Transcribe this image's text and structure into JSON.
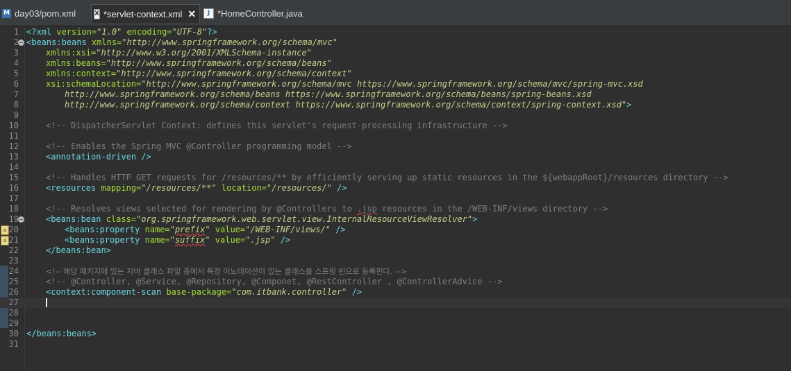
{
  "tabs": [
    {
      "label": "day03/pom.xml",
      "icon": "maven-file-icon"
    },
    {
      "label": "*servlet-context.xml",
      "icon": "xml-file-icon",
      "active": true
    },
    {
      "label": "*HomeController.java",
      "icon": "java-file-icon"
    }
  ],
  "editor": {
    "line_numbers": [
      "1",
      "2",
      "3",
      "4",
      "5",
      "6",
      "7",
      "8",
      "9",
      "10",
      "11",
      "12",
      "13",
      "14",
      "15",
      "16",
      "17",
      "18",
      "19",
      "20",
      "21",
      "22",
      "23",
      "24",
      "25",
      "26",
      "27",
      "28",
      "29",
      "30",
      "31"
    ],
    "lines": {
      "l1": {
        "a": "<?xml ",
        "b": "version=",
        "c": "\"1.0\"",
        "d": " encoding=",
        "e": "\"UTF-8\"",
        "f": "?>"
      },
      "l2": {
        "a": "<beans:beans ",
        "b": "xmlns=",
        "c": "\"http://www.springframework.org/schema/mvc\""
      },
      "l3": {
        "b": "xmlns:xsi=",
        "c": "\"http://www.w3.org/2001/XMLSchema-instance\""
      },
      "l4": {
        "b": "xmlns:beans=",
        "c": "\"http://www.springframework.org/schema/beans\""
      },
      "l5": {
        "b": "xmlns:context=",
        "c": "\"http://www.springframework.org/schema/context\""
      },
      "l6": {
        "b": "xsi:schemaLocation=",
        "c": "\"http://www.springframework.org/schema/mvc https://www.springframework.org/schema/mvc/spring-mvc.xsd"
      },
      "l7": {
        "c": "http://www.springframework.org/schema/beans https://www.springframework.org/schema/beans/spring-beans.xsd"
      },
      "l8": {
        "c": "http://www.springframework.org/schema/context https://www.springframework.org/schema/context/spring-context.xsd\"",
        "f": ">"
      },
      "l10": {
        "a": "<!-- DispatcherServlet Context: defines this servlet's request-processing infrastructure -->"
      },
      "l12": {
        "a": "<!-- Enables the Spring MVC @Controller programming model -->"
      },
      "l13": {
        "a": "<annotation-driven ",
        "f": "/>"
      },
      "l15": {
        "a": "<!-- Handles HTTP GET requests for /resources/** by efficiently serving up static resources in the ${webappRoot}/resources directory -->"
      },
      "l16": {
        "a": "<resources ",
        "b": "mapping=",
        "c": "\"/resources/**\"",
        "d": " location=",
        "e": "\"/resources/\"",
        "f": " />"
      },
      "l18": {
        "a": "<!-- Resolves views selected for rendering by @Controllers to ",
        "s": ".jsp",
        "z": " resources in the /WEB-INF/views directory -->"
      },
      "l19": {
        "a": "<beans:bean ",
        "b": "class=",
        "c": "\"org.springframework.web.servlet.view.InternalResourceViewResolver\"",
        "f": ">"
      },
      "l20": {
        "a": "<beans:property ",
        "b": "name=",
        "c1": "\"",
        "s": "prefix",
        "c2": "\"",
        "d": " value=",
        "e": "\"/WEB-INF/views/\"",
        "f": " />"
      },
      "l21": {
        "a": "<beans:property ",
        "b": "name=",
        "c1": "\"",
        "s": "suffix",
        "c2": "\"",
        "d": " value=",
        "e": "\".jsp\"",
        "f": " />"
      },
      "l22": {
        "a": "</beans:bean>"
      },
      "l24": {
        "a": "<!-- 해당 패키지에 있는 자바 클래스 파일 중에서 특정 어노테이션이 있는 클래스를 스프링 빈으로 등록한다. -->"
      },
      "l25": {
        "a": "<!-- @Controller, @Service, @Repository, @Componet, @RestController , @ControllerAdvice -->"
      },
      "l26": {
        "a": "<context:component-scan ",
        "b": "base-package=",
        "c": "\"com.itbank.controller\"",
        "f": " />"
      },
      "l30": {
        "a": "</beans:beans>"
      }
    }
  },
  "colors": {
    "tag": "#6bd8e4",
    "attr": "#a6dd3a",
    "value": "#c2d38a",
    "comment": "#7b7f85",
    "background": "#2f2f2f"
  }
}
